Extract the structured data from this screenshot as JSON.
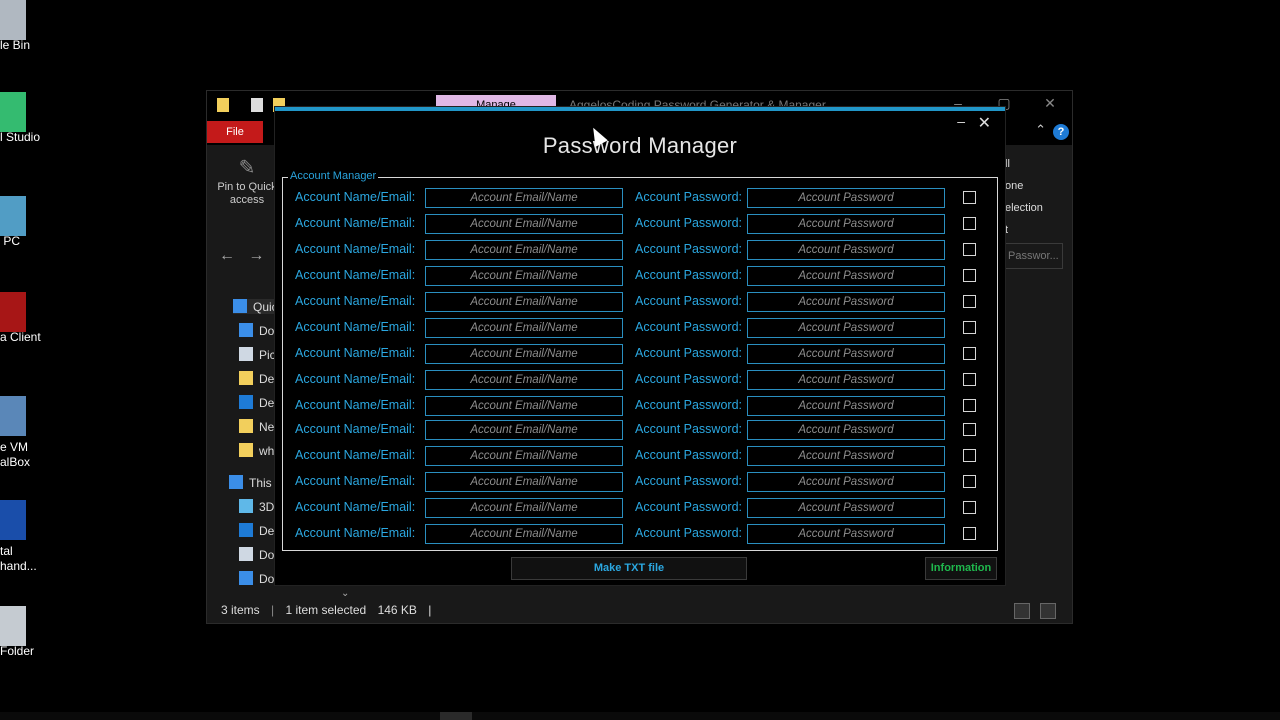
{
  "desktop": {
    "icons": [
      {
        "label": "le Bin",
        "icon": "recycle-bin-icon"
      },
      {
        "label": "l Studio",
        "icon": "android-studio-icon"
      },
      {
        "label": " PC",
        "icon": "this-pc-icon"
      },
      {
        "label": "a Client",
        "icon": "filezilla-icon"
      },
      {
        "label": "e VM\nalBox",
        "icon": "virtualbox-icon"
      },
      {
        "label": "tal\nhand...",
        "icon": "floppy-icon"
      },
      {
        "label": "Folder",
        "icon": "folder-icon"
      }
    ]
  },
  "explorer": {
    "tab_manage": "Manage",
    "window_title": "AggelosCoding Password Generator & Manager",
    "file_tab": "File",
    "pin_label": "Pin to Quick\naccess",
    "tree": [
      {
        "label": "Quic",
        "color": "#3b8ee8"
      },
      {
        "label": "Do",
        "color": "#3b8ee8"
      },
      {
        "label": "Pic",
        "color": "#cfd8e3"
      },
      {
        "label": "De",
        "color": "#f2cf5c"
      },
      {
        "label": "De",
        "color": "#1e7bd6"
      },
      {
        "label": "Ne",
        "color": "#f2cf5c"
      },
      {
        "label": "wh",
        "color": "#f2cf5c"
      },
      {
        "label": "This",
        "color": "#3b8ee8"
      },
      {
        "label": "3D",
        "color": "#5fb8e8"
      },
      {
        "label": "De",
        "color": "#1e7bd6"
      },
      {
        "label": "Do",
        "color": "#cfd8e3"
      },
      {
        "label": "Do",
        "color": "#3b8ee8"
      }
    ],
    "right_items": [
      "ll",
      "one",
      "election",
      "t"
    ],
    "search_placeholder": "Passwor...",
    "status": {
      "items": "3 items",
      "selected": "1 item selected",
      "size": "146 KB"
    }
  },
  "password_manager": {
    "title": "Password Manager",
    "group_label": "Account Manager",
    "email_label": "Account Name/Email:",
    "password_label": "Account Password:",
    "email_placeholder": "Account Email/Name",
    "password_placeholder": "Account Password",
    "row_count": 14,
    "make_txt_button": "Make TXT file",
    "information_button": "Information",
    "colors": {
      "accent": "#2ba7e0",
      "info": "#1fb84d",
      "topbar": "#2196c8"
    }
  }
}
